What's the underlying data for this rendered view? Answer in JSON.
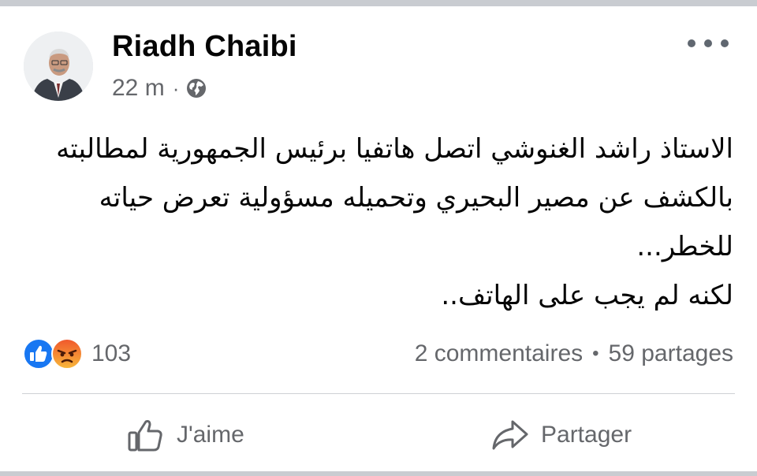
{
  "post": {
    "author": "Riadh Chaibi",
    "time": "22 m",
    "separator": "·",
    "privacy_icon": "globe-icon",
    "text_lines": [
      "الاستاذ راشد الغنوشي اتصل هاتفيا برئيس الجمهورية لمطالبته",
      "بالكشف عن مصير البحيري وتحميله مسؤولية تعرض حياته",
      "للخطر...",
      "لكنه لم يجب على الهاتف.."
    ]
  },
  "reactions": {
    "icons": [
      "like-reaction-icon",
      "angry-reaction-icon"
    ],
    "count": "103"
  },
  "stats": {
    "comments": "2 commentaires",
    "dot": "•",
    "shares": "59 partages"
  },
  "actions": {
    "like_label": "J'aime",
    "share_label": "Partager"
  },
  "colors": {
    "text": "#050505",
    "secondary": "#65676b",
    "like_blue": "#1877f2",
    "angry_top": "#f0562c",
    "angry_bottom": "#f8b93b"
  }
}
